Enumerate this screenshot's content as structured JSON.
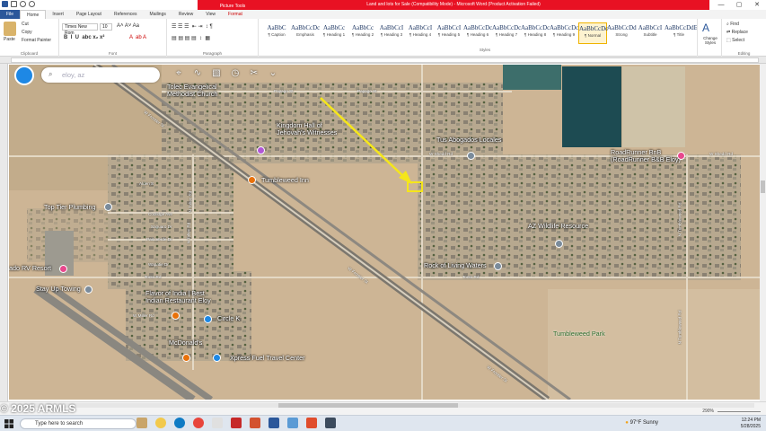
{
  "window": {
    "title": "Land and lots for Sale (Compatibility Mode) - Microsoft Word (Product Activation Failed)",
    "context_tab_group": "Picture Tools",
    "minimize": "—",
    "maximize": "▢",
    "close": "✕"
  },
  "tabs": [
    "File",
    "Home",
    "Insert",
    "Page Layout",
    "References",
    "Mailings",
    "Review",
    "View",
    "Format"
  ],
  "ribbon": {
    "clipboard": {
      "paste": "Paste",
      "cut": "Cut",
      "copy": "Copy",
      "format_painter": "Format Painter",
      "label": "Clipboard"
    },
    "font": {
      "name": "Times New Rom",
      "size": "10",
      "label": "Font"
    },
    "paragraph": {
      "label": "Paragraph"
    },
    "styles": {
      "label": "Styles",
      "items": [
        {
          "preview": "AaBbC",
          "name": "¶ Caption"
        },
        {
          "preview": "AaBbCcDc",
          "name": "Emphasis"
        },
        {
          "preview": "AaBbCc",
          "name": "¶ Heading 1"
        },
        {
          "preview": "AaBbCc",
          "name": "¶ Heading 2"
        },
        {
          "preview": "AaBbCcI",
          "name": "¶ Heading 3"
        },
        {
          "preview": "AaBbCcI",
          "name": "¶ Heading 4"
        },
        {
          "preview": "AaBbCcI",
          "name": "¶ Heading 5"
        },
        {
          "preview": "AaBbCcDc",
          "name": "¶ Heading 6"
        },
        {
          "preview": "AaBbCcDc",
          "name": "¶ Heading 7"
        },
        {
          "preview": "AaBbCcDc",
          "name": "¶ Heading 8"
        },
        {
          "preview": "AaBbCcDc",
          "name": "¶ Heading 9"
        },
        {
          "preview": "AaBbCcDc",
          "name": "¶ Normal"
        },
        {
          "preview": "AaBbCcDd",
          "name": "Strong"
        },
        {
          "preview": "AaBbCcI",
          "name": "Subtitle"
        },
        {
          "preview": "AaBbCcDdE",
          "name": "¶ Title"
        }
      ],
      "change_styles": "Change Styles"
    },
    "editing": {
      "find": "Find",
      "replace": "Replace",
      "select": "Select",
      "label": "Editing"
    }
  },
  "map": {
    "search_placeholder": "eloy, az",
    "labels": [
      {
        "text": "Tolec Evangelical\nMethodist Church"
      },
      {
        "text": "Kingdom Hall of\nJehovah's Witnesses"
      },
      {
        "text": "Tus Abogados Locales"
      },
      {
        "text": "RoadRunner BnB\n(RoadRunner B&B Eloy)"
      },
      {
        "text": "Tumbleweed Inn"
      },
      {
        "text": "Top Tier Plumbing"
      },
      {
        "text": "AZ Wildlife Resource"
      },
      {
        "text": "Rock of Living Waters"
      },
      {
        "text": "ado RV Resort"
      },
      {
        "text": "Stay Up Towing"
      },
      {
        "text": "Flavor of India | Best\nIndian Restaurant Eloy"
      },
      {
        "text": "Circle K"
      },
      {
        "text": "McDonald's"
      },
      {
        "text": "Xpress Fuel Travel Center"
      },
      {
        "text": "Tumbleweed Park"
      }
    ],
    "streets": [
      "Papago St",
      "Papago St",
      "W Frontier St",
      "W Shedd Rd",
      "W Shedd Rd",
      "Alden S",
      "Coolidge Ave",
      "Saguaro Dr",
      "Palo Verde Dr",
      "Wapatie Dr",
      "Tonto Rd",
      "Tonto Rd",
      "W Miller Rd",
      "N Toltec Rd",
      "N Toltec Rd",
      "W Frontier St",
      "W Frontier St",
      "N Tumbleweed Rd",
      "N Tumbleweed Rd"
    ],
    "watermark": "2025 ARMLS"
  },
  "statusbar": {
    "zoom": "290%"
  },
  "taskbar": {
    "search_placeholder": "Type here to search",
    "weather": "97°F  Sunny",
    "time": "12:24 PM",
    "date": "5/28/2025"
  },
  "colors": {
    "word_blue": "#2b579a",
    "title_red": "#e81123",
    "arrow": "#f5e61b"
  }
}
